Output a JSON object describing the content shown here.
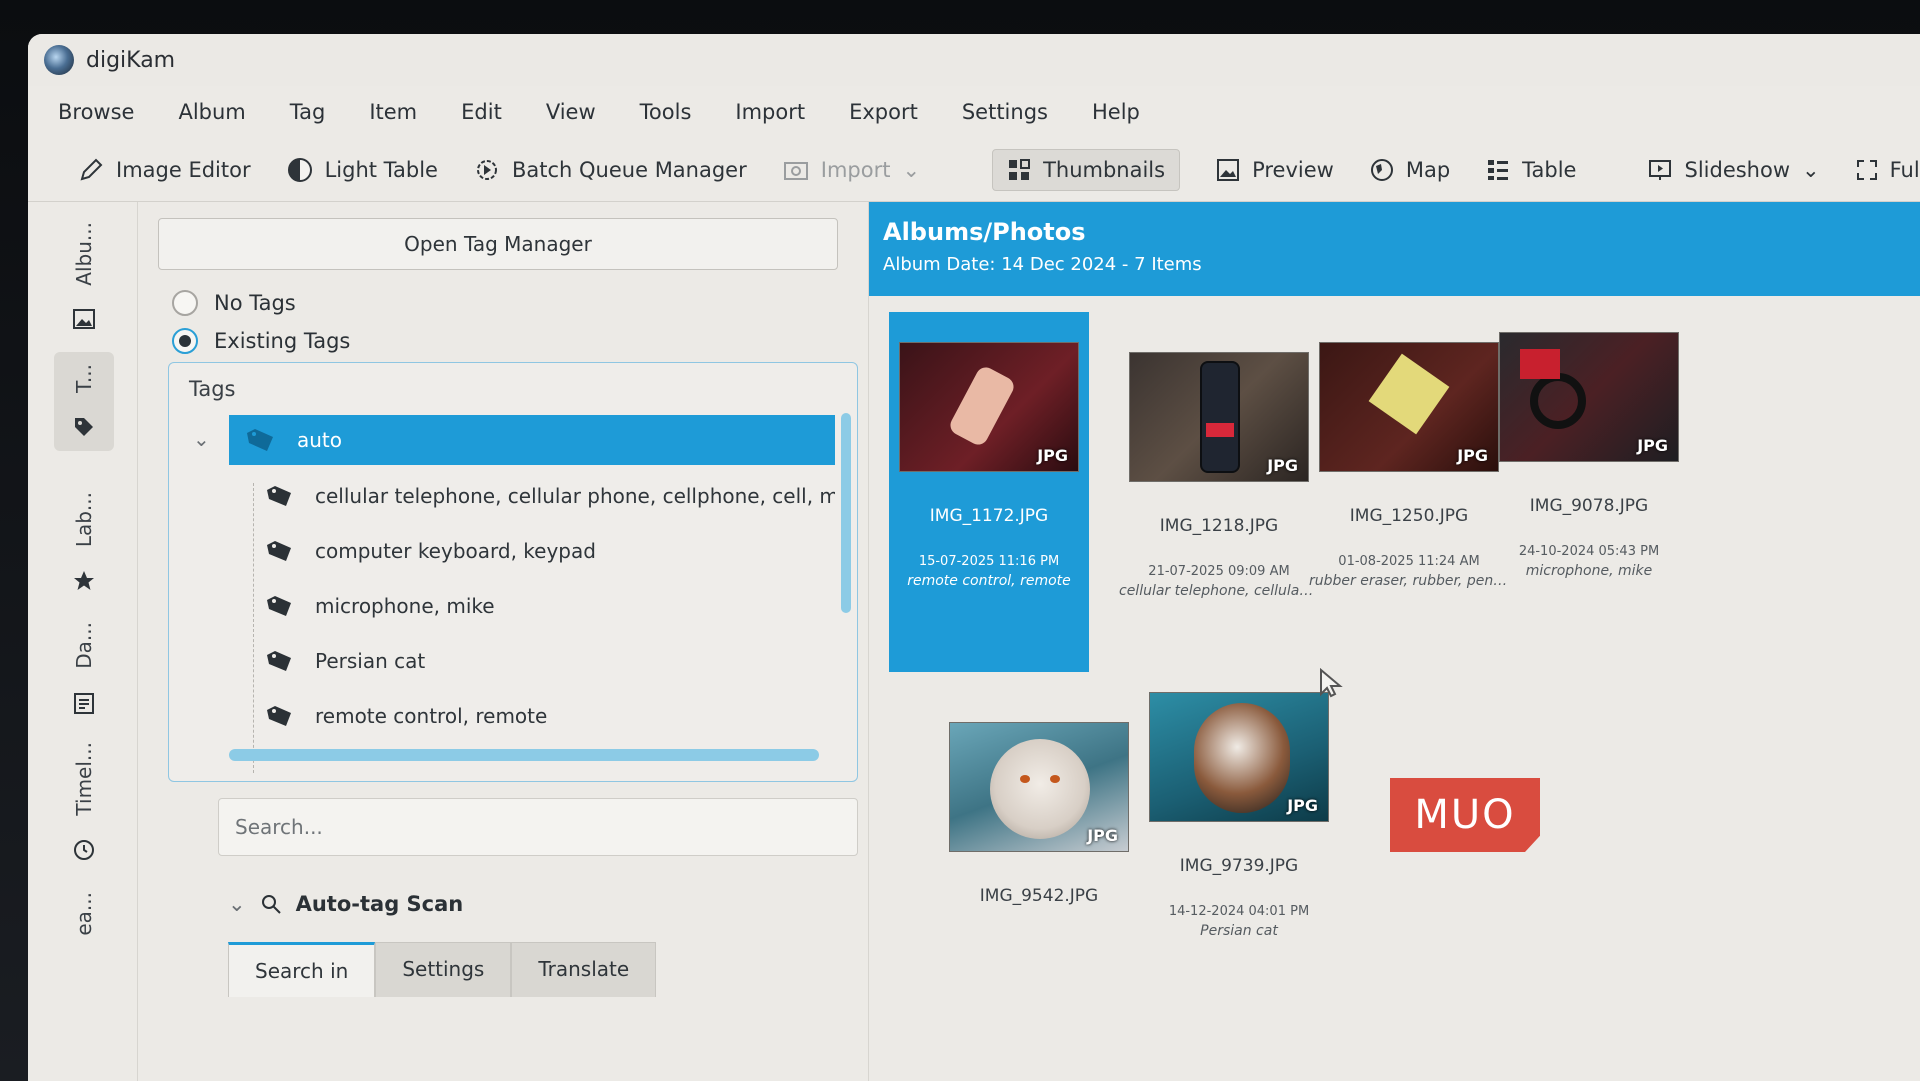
{
  "window": {
    "title": "digiKam"
  },
  "menu": [
    "Browse",
    "Album",
    "Tag",
    "Item",
    "Edit",
    "View",
    "Tools",
    "Import",
    "Export",
    "Settings",
    "Help"
  ],
  "toolbar": {
    "image_editor": "Image Editor",
    "light_table": "Light Table",
    "batch_queue": "Batch Queue Manager",
    "import": "Import",
    "thumbnails": "Thumbnails",
    "preview": "Preview",
    "map": "Map",
    "table": "Table",
    "slideshow": "Slideshow",
    "full_screen": "Full Screen"
  },
  "sidebar": {
    "tabs": [
      "Albu...",
      "T...",
      "Lab...",
      "Da...",
      "Timel...",
      "ea..."
    ]
  },
  "tag_panel": {
    "open_tag_manager": "Open Tag Manager",
    "radio_no_tags": "No Tags",
    "radio_existing_tags": "Existing Tags",
    "tree_header": "Tags",
    "root_tag": "auto",
    "children": [
      "cellular telephone, cellular phone, cellphone, cell, mobile phone",
      "computer keyboard, keypad",
      "microphone, mike",
      "Persian cat",
      "remote control, remote"
    ],
    "search_placeholder": "Search...",
    "autotag_title": "Auto-tag Scan",
    "subtabs": [
      "Search in",
      "Settings",
      "Translate"
    ]
  },
  "album": {
    "title": "Albums/Photos",
    "subtitle": "Album Date: 14 Dec 2024 - 7 Items",
    "jpg_badge": "JPG",
    "items": [
      {
        "name": "IMG_1172.JPG",
        "date": "15-07-2025 11:16 PM",
        "tags": "remote control, remote",
        "selected": true
      },
      {
        "name": "IMG_1218.JPG",
        "date": "21-07-2025 09:09 AM",
        "tags": "cellular telephone, cellular ph...",
        "selected": false
      },
      {
        "name": "IMG_1250.JPG",
        "date": "01-08-2025 11:24 AM",
        "tags": "rubber eraser, rubber, pencil e...",
        "selected": false
      },
      {
        "name": "IMG_9078.JPG",
        "date": "24-10-2024 05:43 PM",
        "tags": "microphone, mike",
        "selected": false
      },
      {
        "name": "IMG_9542.JPG",
        "date": "",
        "tags": "",
        "selected": false
      },
      {
        "name": "IMG_9739.JPG",
        "date": "14-12-2024 04:01 PM",
        "tags": "Persian cat",
        "selected": false
      }
    ]
  },
  "watermark": "MUO",
  "colors": {
    "accent": "#1e9bd7",
    "watermark": "#d94c3f"
  }
}
